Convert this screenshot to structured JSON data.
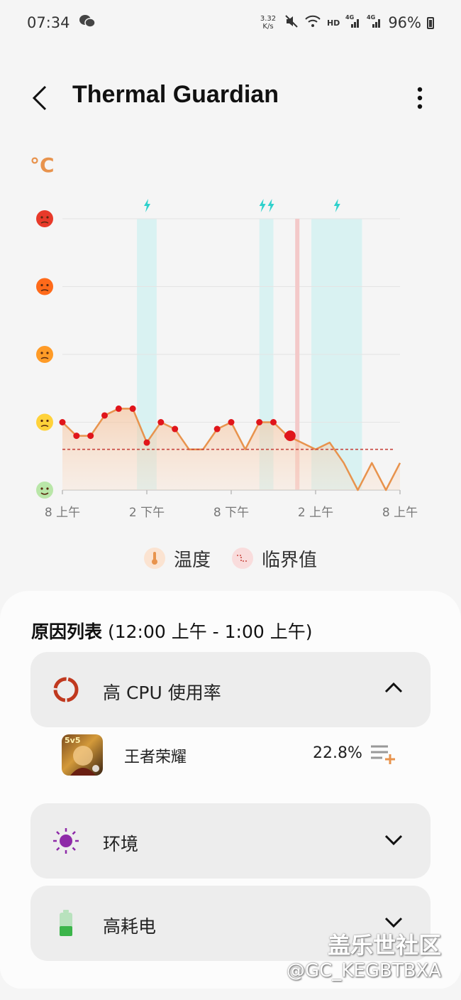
{
  "status_bar": {
    "time": "07:34",
    "net_speed_value": "3.32",
    "net_speed_unit": "K/s",
    "hd": "HD",
    "signal_1": "4G",
    "signal_2": "4G",
    "battery": "96%"
  },
  "app_bar": {
    "title": "Thermal Guardian",
    "back_icon": "chevron-left-icon",
    "more_icon": "more-vertical-icon"
  },
  "chart": {
    "unit": "°C"
  },
  "chart_data": {
    "type": "line",
    "x_tick_labels": [
      "8 上午",
      "2 下午",
      "8 下午",
      "2 上午",
      "8 上午"
    ],
    "x_ticks_hours": [
      0,
      6,
      12,
      18,
      24
    ],
    "y_levels": 4,
    "y_level_icons": [
      "cool-face-icon",
      "neutral-face-icon",
      "sad-face-icon",
      "hot-face-icon",
      "very-hot-face-icon"
    ],
    "series": [
      {
        "name": "温度",
        "x": [
          0,
          1,
          2,
          3,
          4,
          5,
          6,
          7,
          8,
          9,
          10,
          11,
          12,
          13,
          14,
          15,
          16,
          17,
          18,
          19,
          20,
          21,
          22,
          23,
          24
        ],
        "y": [
          1.0,
          0.8,
          0.8,
          1.1,
          1.2,
          1.2,
          0.7,
          1.0,
          0.9,
          0.6,
          0.6,
          0.9,
          1.0,
          0.6,
          1.0,
          1.0,
          0.8,
          0.7,
          0.6,
          0.7,
          0.4,
          0.0,
          0.4,
          0.0,
          0.4
        ],
        "markers": [
          true,
          true,
          true,
          true,
          true,
          true,
          true,
          true,
          true,
          false,
          false,
          true,
          true,
          false,
          true,
          true,
          true,
          false,
          false,
          false,
          false,
          false,
          false,
          false,
          false
        ]
      },
      {
        "name": "临界值",
        "y": 0.6
      }
    ],
    "charging_periods": [
      [
        5.3,
        6.7
      ],
      [
        14.0,
        15.0
      ],
      [
        17.7,
        21.3
      ]
    ],
    "charging_icons_at": [
      6.0,
      14.2,
      14.8,
      19.5
    ],
    "current_time_marker": 16.7,
    "current_point": [
      16.2,
      0.8
    ],
    "ylim": [
      0,
      4
    ],
    "xlim": [
      0,
      24
    ],
    "grid": true
  },
  "legend": {
    "temperature_label": "温度",
    "threshold_label": "临界值"
  },
  "reasons": {
    "title_bold": "原因列表",
    "title_range": "(12:00 上午 - 1:00 上午)",
    "cpu": {
      "label": "高 CPU 使用率",
      "icon": "cpu-ring-icon",
      "expanded": true,
      "apps": [
        {
          "name": "王者荣耀",
          "value": "22.8%",
          "logo_text": "5v5"
        }
      ]
    },
    "environment": {
      "label": "环境",
      "icon": "sun-icon"
    },
    "battery": {
      "label": "高耗电",
      "icon": "battery-icon"
    }
  },
  "watermark": {
    "line1": "盖乐世社区",
    "line2": "@GC_KEGBTBXA"
  },
  "colors": {
    "accent_orange": "#e8934d",
    "marker_red": "#e0151b",
    "charging_band": "#d9f2f2",
    "charging_icon": "#2fd1cc",
    "threshold": "#c8463e",
    "sun_purple": "#8e2ba8",
    "battery_green": "#3bb54a"
  }
}
